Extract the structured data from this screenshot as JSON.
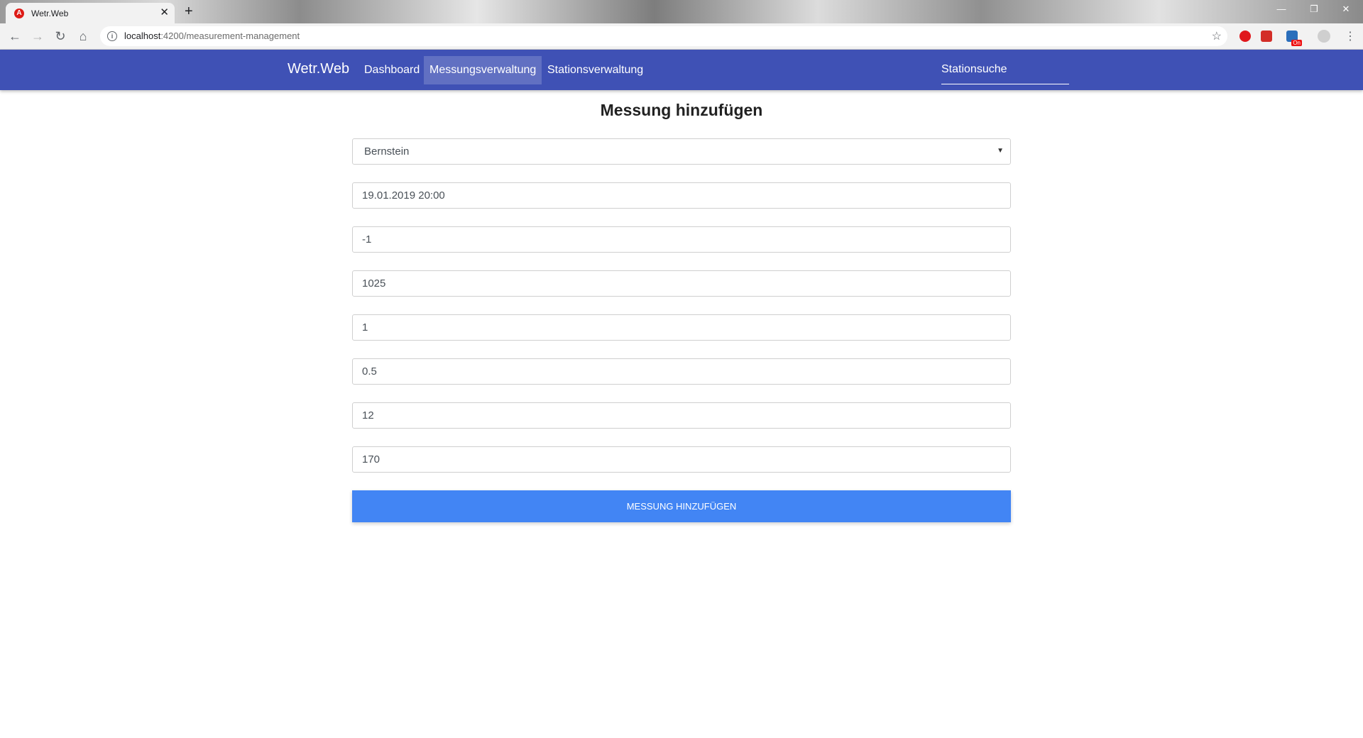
{
  "browser": {
    "tab_title": "Wetr.Web",
    "tab_close": "✕",
    "new_tab": "+",
    "url_host": "localhost",
    "url_path": ":4200/measurement-management",
    "window_controls": [
      "—",
      "❐",
      "✕"
    ]
  },
  "navbar": {
    "brand": "Wetr.Web",
    "items": [
      {
        "label": "Dashboard",
        "active": false
      },
      {
        "label": "Messungsverwaltung",
        "active": true
      },
      {
        "label": "Stationsverwaltung",
        "active": false
      }
    ],
    "search_placeholder": "Stationsuche",
    "color": "#3f51b5"
  },
  "form": {
    "title": "Messung hinzufügen",
    "station": "Bernstein",
    "datetime": "19.01.2019 20:00",
    "values": [
      "-1",
      "1025",
      "1",
      "0.5",
      "12",
      "170"
    ],
    "submit_label": "Messung hinzufügen",
    "button_color": "#4285f4"
  }
}
